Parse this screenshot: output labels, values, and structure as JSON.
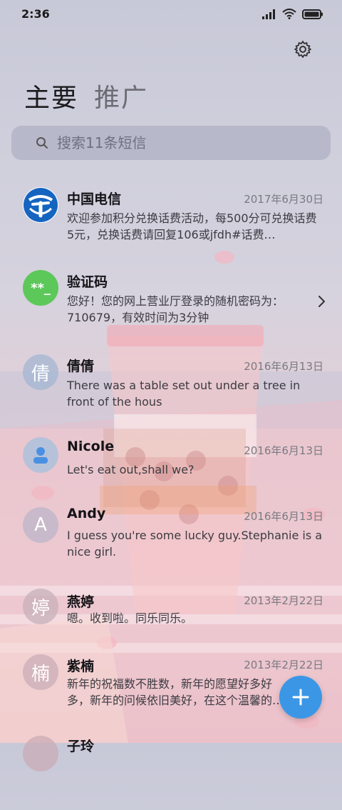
{
  "status_bar": {
    "time": "2:36"
  },
  "tabs": [
    {
      "label": "主要",
      "active": true
    },
    {
      "label": "推广",
      "active": false
    }
  ],
  "search": {
    "placeholder": "搜索11条短信"
  },
  "conversations": [
    {
      "name": "中国电信",
      "date": "2017年6月30日",
      "preview": "欢迎参加积分兑换话费活动，每500分可兑换话费5元，兑换话费请回复106或jfdh#话费…",
      "avatar": "telecom-logo-icon",
      "avatar_color": "#1565c0"
    },
    {
      "name": "验证码",
      "date": "",
      "preview": "您好！您的网上营业厅登录的随机密码为：710679，有效时间为3分钟",
      "avatar_text": "**_",
      "avatar_color": "#5cc85a"
    },
    {
      "name": "倩倩",
      "date": "2016年6月13日",
      "preview": "There was a table set out under a tree in front of the hous",
      "avatar_text": "倩",
      "avatar_color": "#9fb5d2"
    },
    {
      "name": "Nicole",
      "date": "2016年6月13日",
      "preview": "Let's eat out,shall we?",
      "avatar": "person-icon",
      "avatar_color": "#a9c0dc"
    },
    {
      "name": "Andy",
      "date": "2016年6月13日",
      "preview": "I guess you're some lucky guy.Stephanie is a nice girl.",
      "avatar_text": "A",
      "avatar_color": "#b9b3c8"
    },
    {
      "name": "燕婷",
      "date": "2013年2月22日",
      "preview": "嗯。收到啦。同乐同乐。",
      "avatar_text": "婷",
      "avatar_color": "#c4aeb8"
    },
    {
      "name": "紫楠",
      "date": "2013年2月22日",
      "preview": "新年的祝福数不胜数，新年的愿望好多好多，新年的问候依旧美好，在这个温馨的时刻",
      "avatar_text": "楠",
      "avatar_color": "#c7abb6"
    },
    {
      "name": "子玲",
      "date": "",
      "preview": "",
      "avatar_text": "",
      "avatar_color": "#c9a9b4"
    }
  ],
  "colors": {
    "accent": "#3b97e6",
    "verify_green": "#5cc85a",
    "telecom_blue": "#1565c0"
  },
  "fab": {
    "icon": "plus-icon"
  }
}
